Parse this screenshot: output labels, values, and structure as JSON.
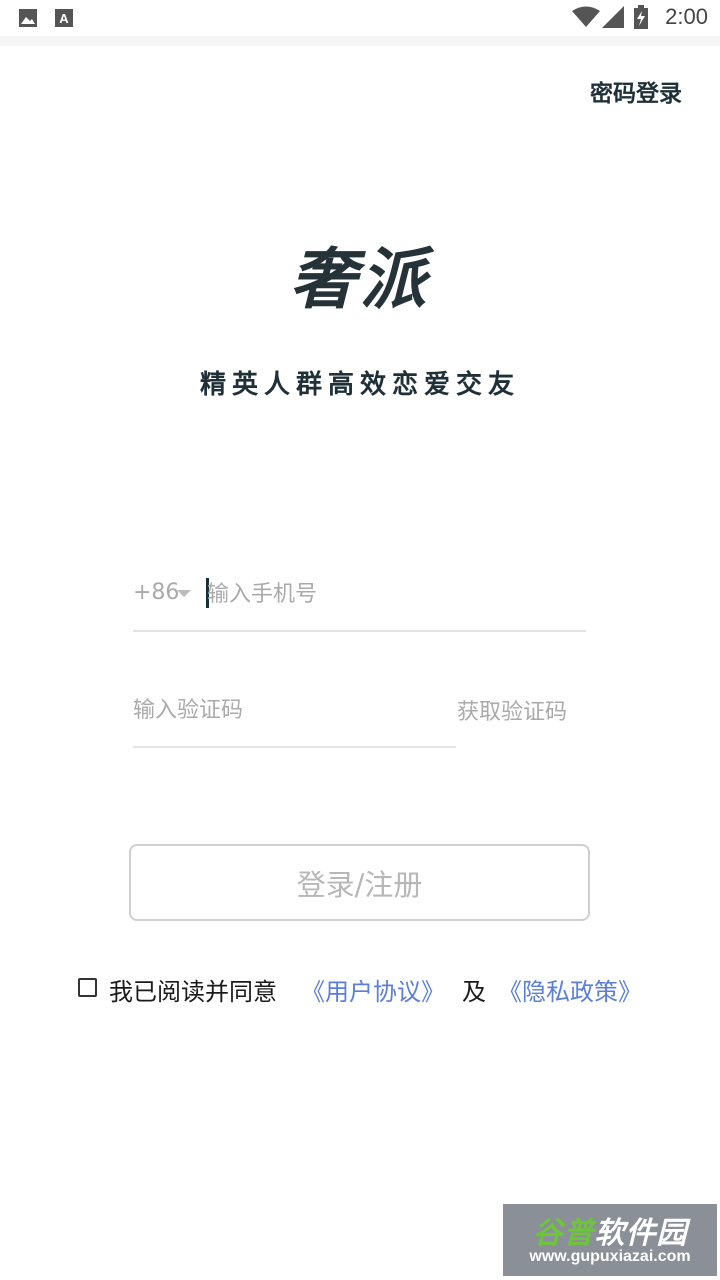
{
  "status_bar": {
    "time": "2:00",
    "icons": [
      "image-icon",
      "font-icon",
      "wifi-icon",
      "signal-icon",
      "battery-charging-icon"
    ]
  },
  "header": {
    "password_login": "密码登录"
  },
  "brand": {
    "logo_text": "奢派",
    "slogan": "精英人群高效恋爱交友"
  },
  "phone": {
    "country_code": "+86",
    "placeholder": "输入手机号",
    "value": ""
  },
  "verify": {
    "placeholder": "输入验证码",
    "value": "",
    "get_code_label": "获取验证码"
  },
  "login_button": {
    "label": "登录/注册"
  },
  "agreement": {
    "checked": false,
    "prefix": "我已阅读并同意",
    "user_agreement": "《用户协议》",
    "and": "及",
    "privacy_policy": "《隐私政策》",
    "link_color": "#5b7fd6"
  },
  "watermark": {
    "title_a": "谷普",
    "title_b": "软件园",
    "url": "www.gupuxiazai.com"
  }
}
